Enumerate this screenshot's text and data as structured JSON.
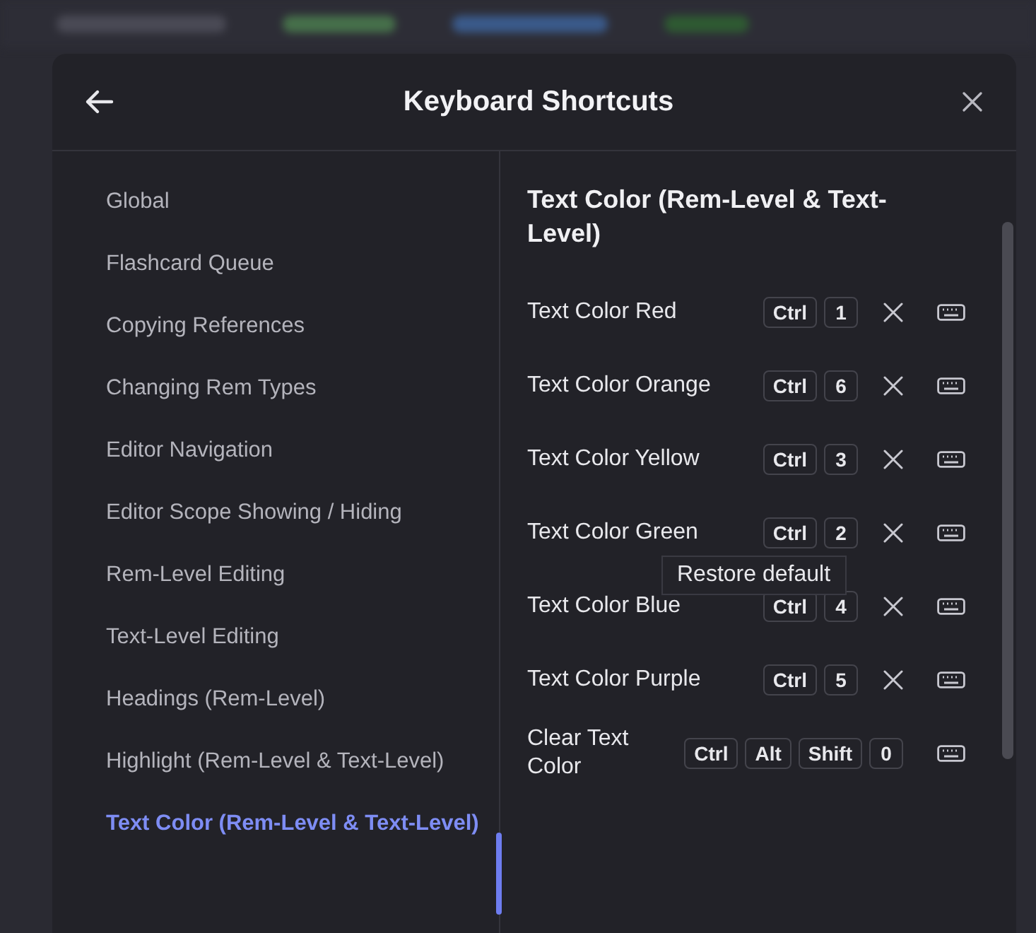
{
  "dialog": {
    "title": "Keyboard Shortcuts"
  },
  "sidebar": {
    "items": [
      {
        "label": "Global",
        "selected": false
      },
      {
        "label": "Flashcard Queue",
        "selected": false
      },
      {
        "label": "Copying References",
        "selected": false
      },
      {
        "label": "Changing Rem Types",
        "selected": false
      },
      {
        "label": "Editor Navigation",
        "selected": false
      },
      {
        "label": "Editor Scope Showing / Hiding",
        "selected": false
      },
      {
        "label": "Rem-Level Editing",
        "selected": false
      },
      {
        "label": "Text-Level Editing",
        "selected": false
      },
      {
        "label": "Headings (Rem-Level)",
        "selected": false
      },
      {
        "label": "Highlight (Rem-Level & Text-Level)",
        "selected": false
      },
      {
        "label": "Text Color (Rem-Level & Text-Level)",
        "selected": true
      }
    ]
  },
  "section": {
    "title": "Text Color (Rem-Level & Text-Level)",
    "shortcuts": [
      {
        "name": "Text Color Red",
        "keys": [
          "Ctrl",
          "1"
        ],
        "resettable": true
      },
      {
        "name": "Text Color Orange",
        "keys": [
          "Ctrl",
          "6"
        ],
        "resettable": true
      },
      {
        "name": "Text Color Yellow",
        "keys": [
          "Ctrl",
          "3"
        ],
        "resettable": true
      },
      {
        "name": "Text Color Green",
        "keys": [
          "Ctrl",
          "2"
        ],
        "resettable": true
      },
      {
        "name": "Text Color Blue",
        "keys": [
          "Ctrl",
          "4"
        ],
        "resettable": true
      },
      {
        "name": "Text Color Purple",
        "keys": [
          "Ctrl",
          "5"
        ],
        "resettable": true
      },
      {
        "name": "Clear Text Color",
        "keys": [
          "Ctrl",
          "Alt",
          "Shift",
          "0"
        ],
        "resettable": false
      }
    ]
  },
  "tooltip": {
    "text": "Restore default"
  }
}
